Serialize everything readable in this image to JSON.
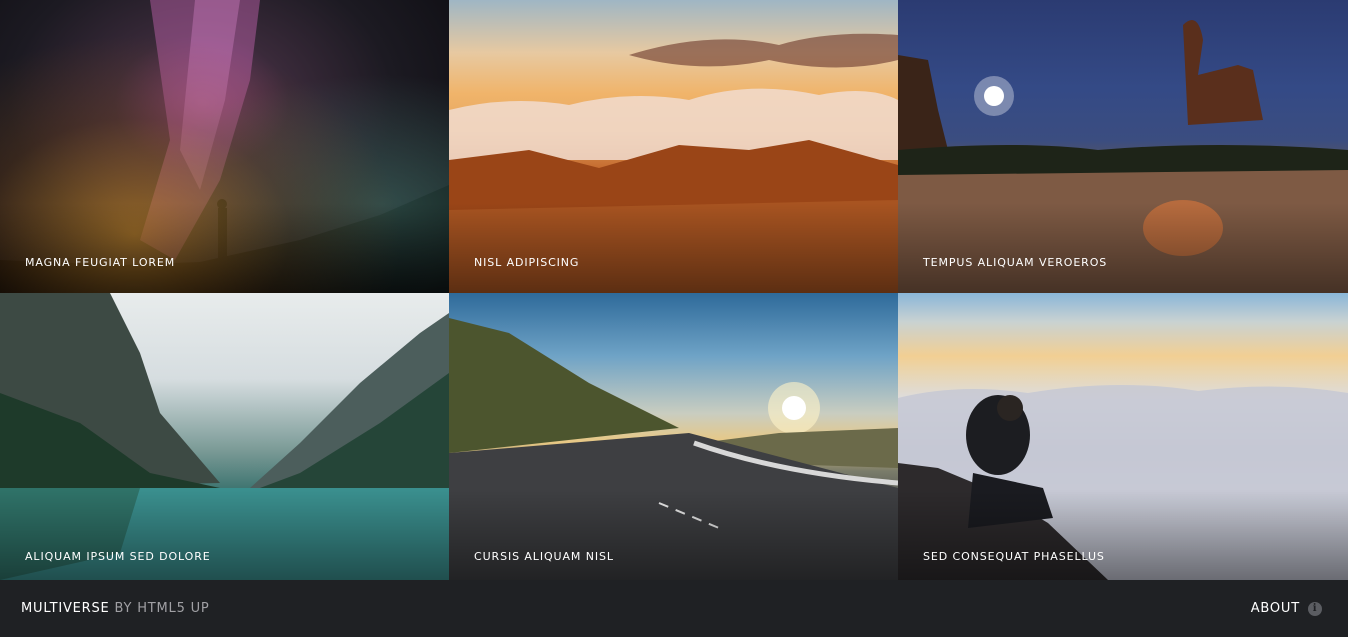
{
  "gallery": {
    "items": [
      {
        "caption": "MAGNA FEUGIAT LOREM"
      },
      {
        "caption": "NISL ADIPISCING"
      },
      {
        "caption": "TEMPUS ALIQUAM VEROEROS"
      },
      {
        "caption": "ALIQUAM IPSUM SED DOLORE"
      },
      {
        "caption": "CURSIS ALIQUAM NISL"
      },
      {
        "caption": "SED CONSEQUAT PHASELLUS"
      }
    ]
  },
  "footer": {
    "brand": "MULTIVERSE",
    "byline": "BY HTML5 UP",
    "about_label": "ABOUT",
    "about_icon": "info-icon"
  },
  "colors": {
    "footer_bg": "#1f2124",
    "caption_text": "#ffffff",
    "byline_text": "#a0a0a4"
  }
}
